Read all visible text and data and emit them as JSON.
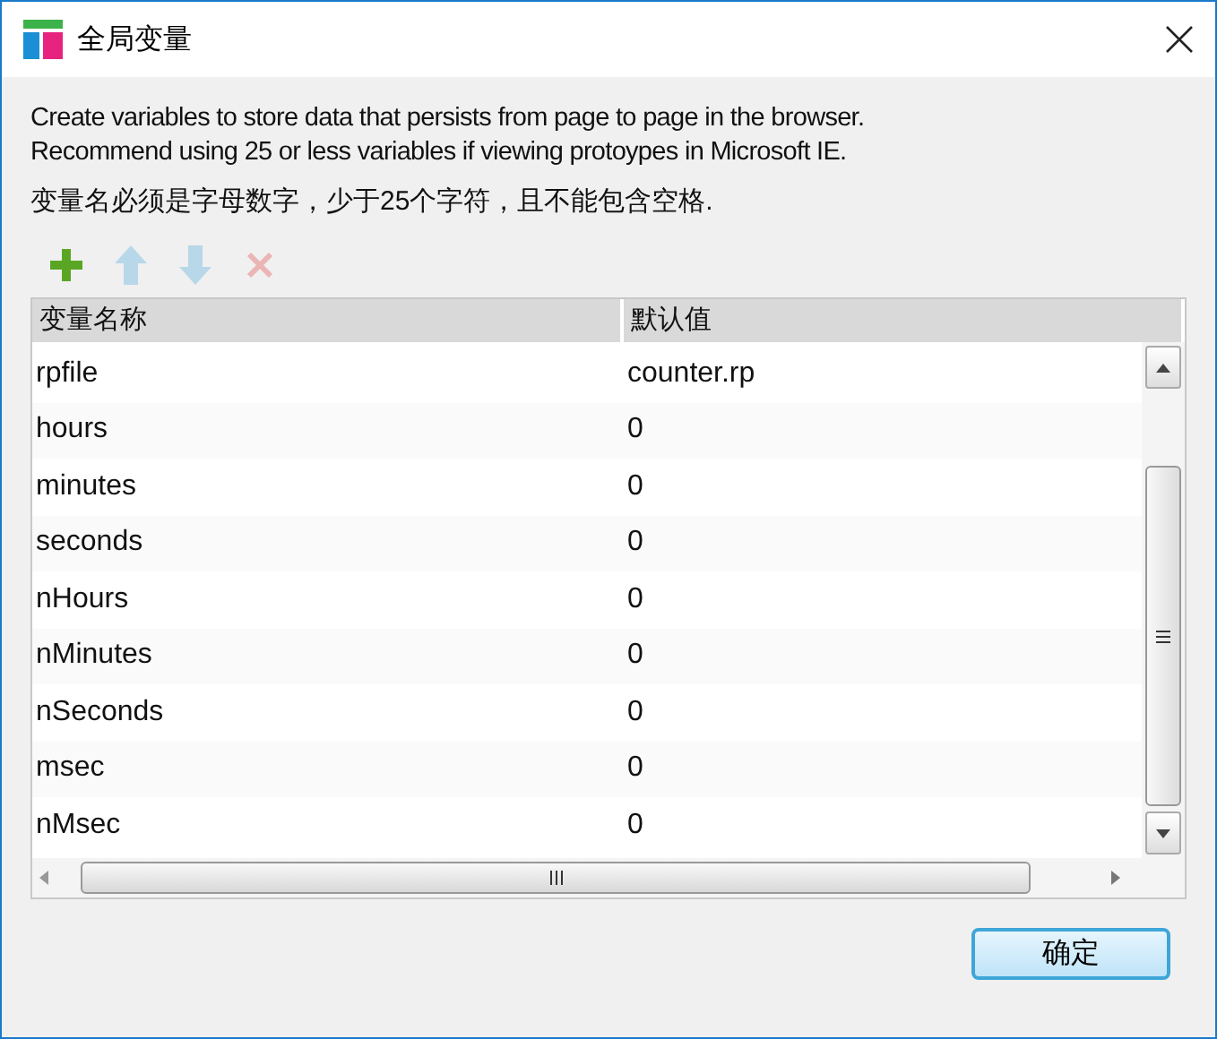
{
  "window": {
    "title": "全局变量"
  },
  "description": [
    "Create variables to store data that persists from page to page in the browser.",
    "Recommend using 25 or less variables if viewing protoypes in Microsoft IE."
  ],
  "hint": "变量名必须是字母数字，少于25个字符，且不能包含空格.",
  "toolbar": [
    {
      "kind": "add",
      "disabled": false
    },
    {
      "kind": "up",
      "disabled": true
    },
    {
      "kind": "down",
      "disabled": true
    },
    {
      "kind": "delete",
      "disabled": true
    }
  ],
  "table": {
    "columns": [
      "变量名称",
      "默认值"
    ],
    "rows": [
      {
        "name": "rpfile",
        "value": "counter.rp"
      },
      {
        "name": "hours",
        "value": "0"
      },
      {
        "name": "minutes",
        "value": "0"
      },
      {
        "name": "seconds",
        "value": "0"
      },
      {
        "name": "nHours",
        "value": "0"
      },
      {
        "name": "nMinutes",
        "value": "0"
      },
      {
        "name": "nSeconds",
        "value": "0"
      },
      {
        "name": "msec",
        "value": "0"
      },
      {
        "name": "nMsec",
        "value": "0"
      }
    ]
  },
  "buttons": [
    "确定"
  ]
}
